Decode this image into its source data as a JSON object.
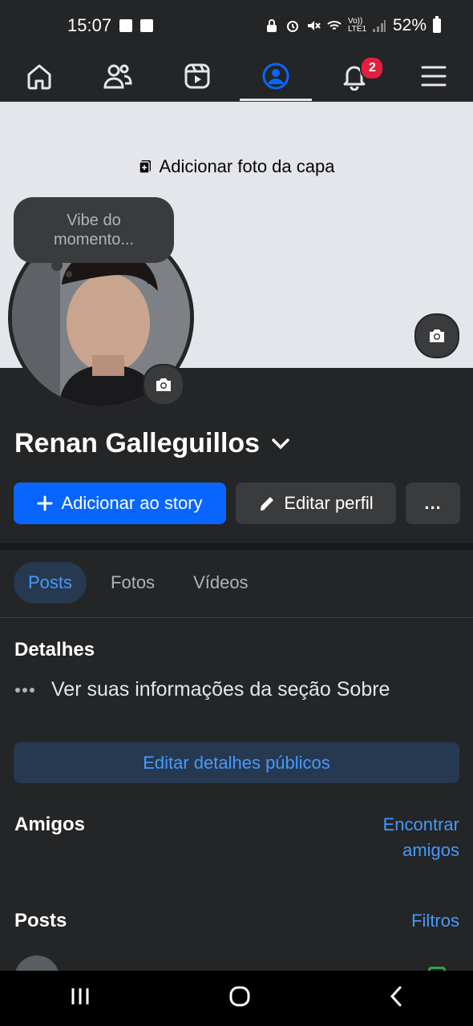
{
  "status_bar": {
    "time": "15:07",
    "battery": "52%",
    "left_icons": [
      "facebook-notification-icon",
      "voicemail-notification-icon"
    ],
    "right_icons": [
      "lock-icon",
      "alarm-icon",
      "mute-icon",
      "wifi-icon",
      "volte-icon",
      "signal-icon",
      "battery-icon"
    ],
    "signal_label": "Vo)) LTE1"
  },
  "nav": {
    "items": [
      {
        "name": "home",
        "icon": "home-icon"
      },
      {
        "name": "friends",
        "icon": "friends-icon"
      },
      {
        "name": "video",
        "icon": "video-icon"
      },
      {
        "name": "profile",
        "icon": "profile-icon",
        "active": true
      },
      {
        "name": "notifications",
        "icon": "bell-icon",
        "badge": "2"
      },
      {
        "name": "menu",
        "icon": "menu-icon"
      }
    ]
  },
  "cover": {
    "add_cover_label": "Adicionar foto da capa"
  },
  "profile": {
    "mood_bubble": [
      "Vibe do",
      "momento..."
    ],
    "name": "Renan Galleguillos"
  },
  "actions": {
    "add_story": "Adicionar ao story",
    "edit_profile": "Editar perfil",
    "more": "..."
  },
  "tabs": [
    {
      "label": "Posts",
      "active": true
    },
    {
      "label": "Fotos"
    },
    {
      "label": "Vídeos"
    }
  ],
  "details": {
    "title": "Detalhes",
    "about_link": "Ver suas informações da seção Sobre",
    "edit_public": "Editar detalhes públicos"
  },
  "friends": {
    "title": "Amigos",
    "find_line1": "Encontrar",
    "find_line2": "amigos"
  },
  "posts": {
    "title": "Posts",
    "filters": "Filtros"
  },
  "colors": {
    "accent": "#0866ff",
    "link": "#4599ff",
    "badge": "#e41e3f"
  }
}
